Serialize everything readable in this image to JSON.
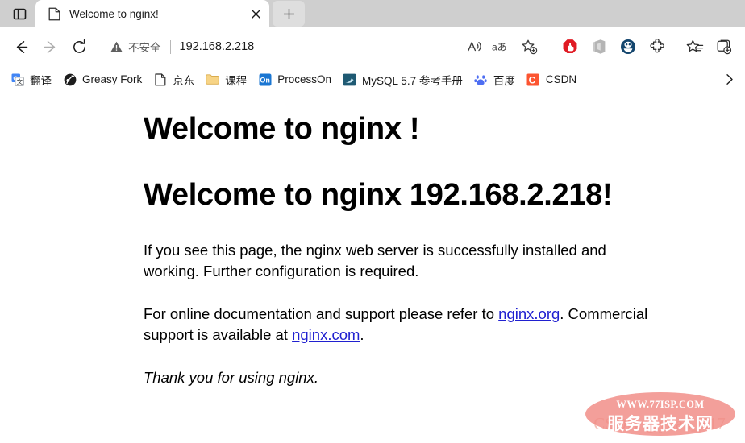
{
  "browser": {
    "tab_actions_icon": "vertical-tabs-icon",
    "tab": {
      "favicon": "document-icon",
      "title": "Welcome to nginx!",
      "close_icon": "close-icon"
    },
    "new_tab_icon": "plus-icon",
    "nav": {
      "back_icon": "arrow-left-icon",
      "forward_icon": "arrow-right-icon",
      "reload_icon": "reload-icon"
    },
    "omnibox": {
      "security_icon": "warning-triangle-icon",
      "security_text": "不安全",
      "url": "192.168.2.218",
      "actions": [
        {
          "name": "read-aloud-icon",
          "glyph": "A"
        },
        {
          "name": "translate-icon",
          "glyph": "aあ"
        },
        {
          "name": "add-favorite-icon",
          "glyph": "star-plus"
        }
      ]
    },
    "toolbar": [
      {
        "name": "adblock-extension-icon",
        "color": "#e01b24"
      },
      {
        "name": "office-extension-icon",
        "color": "#b5b5b5"
      },
      {
        "name": "edge-extension-icon",
        "color": "#14466e"
      },
      {
        "name": "extensions-puzzle-icon",
        "color": "#2b2b2b"
      },
      {
        "name": "favorites-icon",
        "color": "#2b2b2b"
      },
      {
        "name": "collections-icon",
        "color": "#2b2b2b"
      }
    ],
    "bookmarks": [
      {
        "label": "翻译",
        "icon": "google-translate-icon"
      },
      {
        "label": "Greasy Fork",
        "icon": "greasy-fork-icon"
      },
      {
        "label": "京东",
        "icon": "document-icon"
      },
      {
        "label": "课程",
        "icon": "folder-icon"
      },
      {
        "label": "ProcessOn",
        "icon": "processon-icon"
      },
      {
        "label": "MySQL 5.7 参考手册",
        "icon": "mysql-dolphin-icon"
      },
      {
        "label": "百度",
        "icon": "baidu-paw-icon"
      },
      {
        "label": "CSDN",
        "icon": "csdn-icon"
      }
    ],
    "bookmarks_overflow_icon": "chevron-right-icon"
  },
  "page": {
    "heading1": "Welcome to nginx !",
    "heading2": "Welcome to nginx 192.168.2.218!",
    "paragraph1": "If you see this page, the nginx web server is successfully installed and working. Further configuration is required.",
    "links_intro": "For online documentation and support please refer to ",
    "link_org": "nginx.org",
    "links_mid": ". Commercial support is available at ",
    "link_com": "nginx.com",
    "links_end": ".",
    "thanks": "Thank you for using nginx."
  },
  "watermark": {
    "faint_text": "CSDN @yuan_317",
    "line1": "WWW.77ISP.COM",
    "line2": "服务器技术网",
    "ellipse_color": "#f08a84"
  }
}
